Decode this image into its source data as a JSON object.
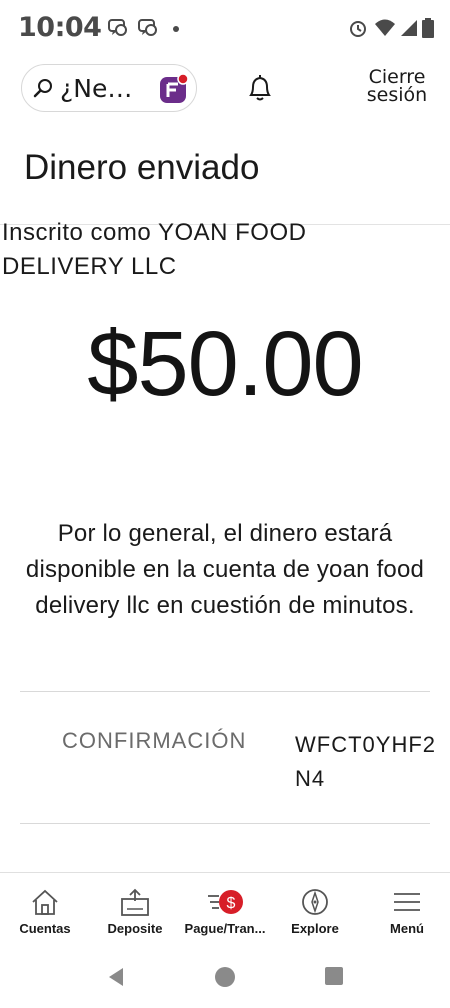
{
  "status_bar": {
    "time": "10:04",
    "icons": [
      "chat-icon",
      "chat-icon",
      "alarm-icon",
      "wifi-icon",
      "signal-icon",
      "battery-icon"
    ],
    "icon_color": "#4a4a4a"
  },
  "header": {
    "search_placeholder": "¿Ne…",
    "logout_label_line1": "Cierre",
    "logout_label_line2": "sesión",
    "badge_color": "#6b2d8a",
    "badge_accent": "#d71e28"
  },
  "page": {
    "title": "Dinero enviado",
    "enrolled_line1": "Inscrito como YOAN FOOD",
    "enrolled_line2": "DELIVERY LLC",
    "amount": "$50.00",
    "info_message": "Por lo general, el dinero estará disponible en la cuenta de yoan food delivery llc en cuestión de minutos.",
    "confirmation_label": "CONFIRMACIÓN",
    "confirmation_value": "WFCT0YHF2N4"
  },
  "bottom_nav": {
    "items": [
      {
        "label": "Cuentas",
        "icon": "house-icon"
      },
      {
        "label": "Deposite",
        "icon": "deposit-icon"
      },
      {
        "label": "Pague/Tran...",
        "icon": "pay-transfer-icon"
      },
      {
        "label": "Explore",
        "icon": "compass-icon"
      },
      {
        "label": "Menú",
        "icon": "hamburger-icon"
      }
    ],
    "accent_color": "#d71e28"
  },
  "system_nav": {
    "icons": [
      "back-icon",
      "home-icon",
      "recents-icon"
    ],
    "color": "#8a8a8a"
  }
}
